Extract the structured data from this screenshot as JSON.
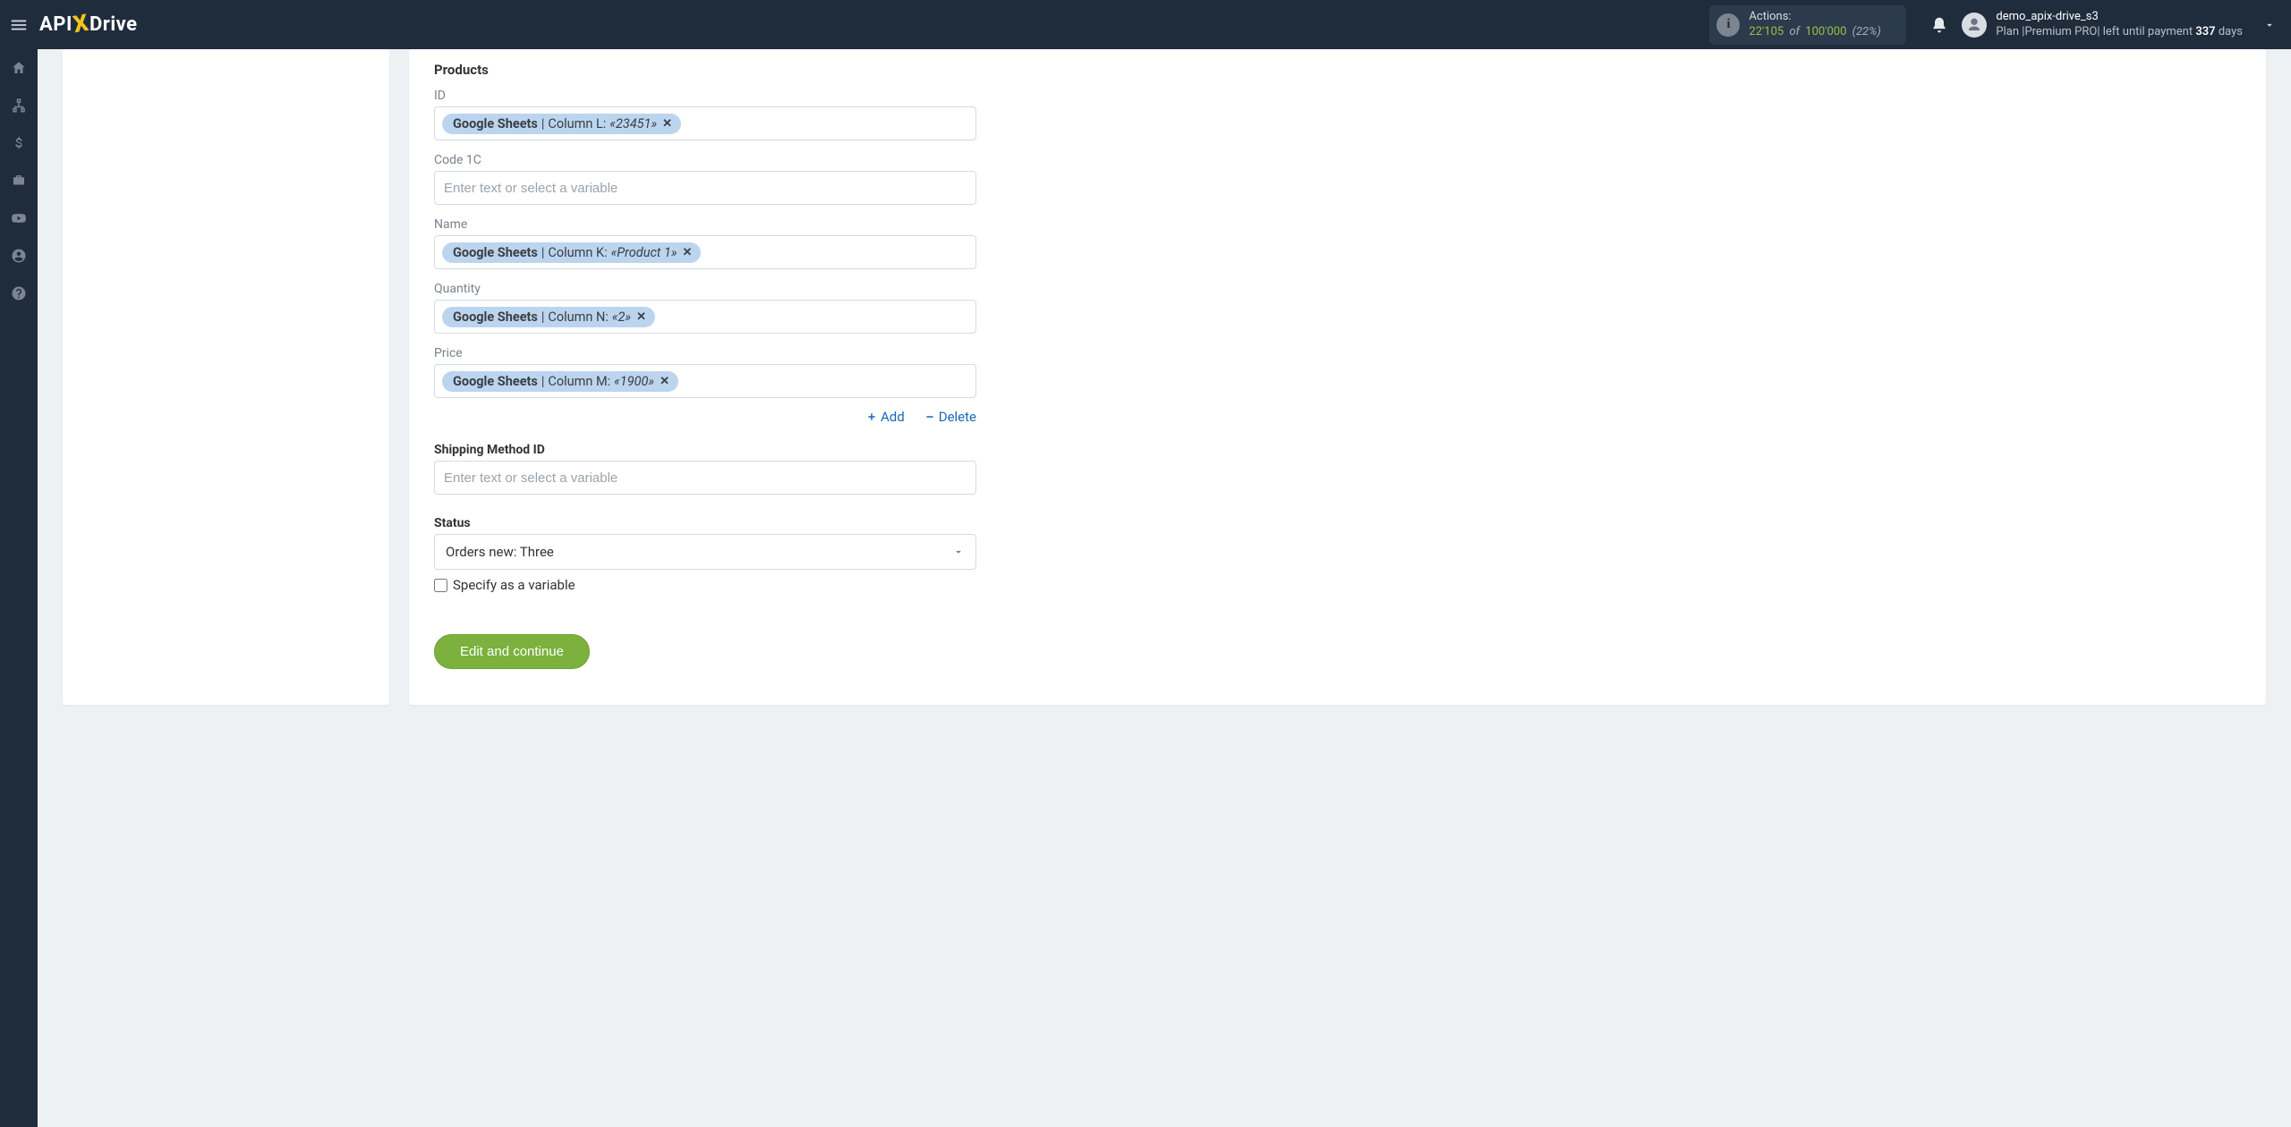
{
  "header": {
    "logo": {
      "part1": "API",
      "part2": "X",
      "part3": "Drive"
    },
    "actions": {
      "label": "Actions:",
      "used": "22'105",
      "of_word": "of",
      "max": "100'000",
      "pct": "(22%)"
    },
    "user": {
      "name": "demo_apix-drive_s3",
      "plan_prefix": "Plan |",
      "plan_name": "Premium PRO",
      "plan_mid": "| left until payment ",
      "days": "337",
      "days_suffix": " days"
    }
  },
  "form": {
    "section_products": "Products",
    "placeholder": "Enter text or select a variable",
    "fields": {
      "id": {
        "label": "ID",
        "chip": {
          "source": "Google Sheets",
          "column": "Column L:",
          "value": "«23451»"
        }
      },
      "code1c": {
        "label": "Code 1C"
      },
      "name": {
        "label": "Name",
        "chip": {
          "source": "Google Sheets",
          "column": "Column K:",
          "value": "«Product 1»"
        }
      },
      "quantity": {
        "label": "Quantity",
        "chip": {
          "source": "Google Sheets",
          "column": "Column N:",
          "value": "«2»"
        }
      },
      "price": {
        "label": "Price",
        "chip": {
          "source": "Google Sheets",
          "column": "Column M:",
          "value": "«1900»"
        }
      }
    },
    "actions": {
      "add": "Add",
      "delete": "Delete"
    },
    "shipping": {
      "label": "Shipping Method ID"
    },
    "status": {
      "label": "Status",
      "selected": "Orders new: Three",
      "checkbox": "Specify as a variable"
    },
    "submit": "Edit and continue"
  }
}
